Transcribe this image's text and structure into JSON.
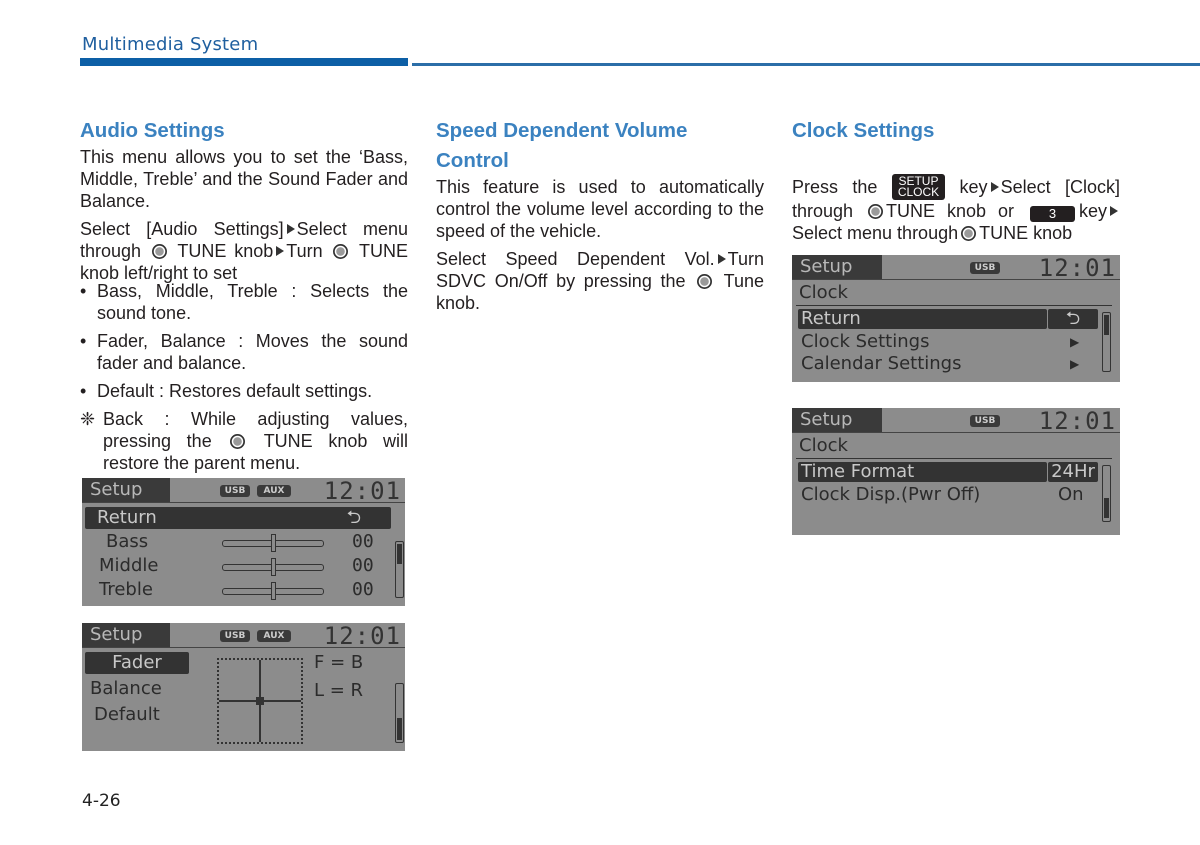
{
  "header": {
    "section_title": "Multimedia System"
  },
  "page_number": "4-26",
  "audio_settings": {
    "heading": "Audio Settings",
    "intro": "This menu allows you to set the ‘Bass, Middle, Treble’ and the Sound Fader and Balance.",
    "steps": {
      "part1": "Select [Audio Settings]",
      "part2": "Select menu through",
      "part3": "TUNE knob",
      "part4": "Turn",
      "part5": "TUNE knob left/right to set"
    },
    "bullets": [
      "Bass, Middle, Treble : Selects the sound tone.",
      "Fader, Balance : Moves the sound fader and balance.",
      "Default : Restores default settings."
    ],
    "note": {
      "mark": "❈",
      "part1": "Back : While adjusting values, pressing the",
      "part2": "TUNE knob will restore the parent menu."
    },
    "screen_tone": {
      "tab": "Setup",
      "badges": [
        "USB",
        "AUX"
      ],
      "time": "12:01",
      "return_label": "Return",
      "return_icon": "return-arrow-icon",
      "rows": [
        {
          "label": "Bass",
          "value": "00",
          "slider_level": 0.5
        },
        {
          "label": "Middle",
          "value": "00",
          "slider_level": 0.5
        },
        {
          "label": "Treble",
          "value": "00",
          "slider_level": 0.5
        }
      ]
    },
    "screen_fader": {
      "tab": "Setup",
      "badges": [
        "USB",
        "AUX"
      ],
      "time": "12:01",
      "menu": [
        "Fader",
        "Balance",
        "Default"
      ],
      "selected": "Fader",
      "fader_readout": "F = B",
      "balance_readout": "L = R"
    }
  },
  "sdvc": {
    "heading_line1": "Speed Dependent Volume",
    "heading_line2": "Control",
    "intro": "This feature is used to automatically control the volume level according to the speed of the vehicle.",
    "step_part1": "Select Speed Dependent Vol.",
    "step_part2": "Turn SDVC On/Off by pressing the",
    "step_part3": "Tune knob."
  },
  "clock_settings": {
    "heading": "Clock Settings",
    "instr": {
      "part1": "Press the",
      "key_line1": "SETUP",
      "key_line2": "CLOCK",
      "part2": "key",
      "part3": "Select [Clock] through",
      "part4": "TUNE knob or",
      "num_key": "3",
      "part5": "key",
      "part6": "Select menu through",
      "part7": "TUNE knob"
    },
    "screen_menu": {
      "tab": "Setup",
      "badge": "USB",
      "time": "12:01",
      "subtitle": "Clock",
      "items": [
        {
          "label": "Return",
          "icon": "return-arrow-icon"
        },
        {
          "label": "Clock Settings",
          "icon": "submenu-arrow-icon"
        },
        {
          "label": "Calendar Settings",
          "icon": "submenu-arrow-icon"
        }
      ]
    },
    "screen_format": {
      "tab": "Setup",
      "badge": "USB",
      "time": "12:01",
      "subtitle": "Clock",
      "items": [
        {
          "label": "Time Format",
          "value": "24Hr"
        },
        {
          "label": "Clock Disp.(Pwr Off)",
          "value": "On"
        }
      ]
    }
  }
}
